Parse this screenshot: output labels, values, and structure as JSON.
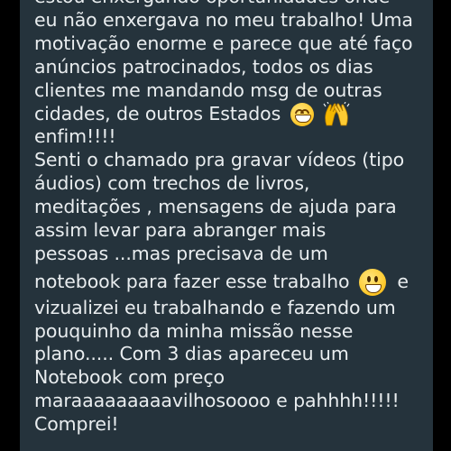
{
  "message": {
    "lines": [
      "estou enxergando oportunidades onde",
      "eu não enxergava no meu trabalho! Uma",
      "motivação enorme e parece que até faço",
      "anúncios patrocinados, todos os dias",
      "clientes me mandando msg de outras",
      "cidades, de outros Estados",
      "enfim!!!!",
      "Senti o chamado pra gravar vídeos (tipo",
      "áudios) com trechos de livros,",
      "meditações , mensagens de ajuda para",
      "assim levar para abranger mais",
      "pessoas ...mas precisava de um",
      "notebook para fazer esse trabalho",
      "vizualizei eu trabalhando e fazendo um",
      "pouquinho da minha missão nesse",
      "plano..... Com 3 dias apareceu um",
      "Notebook com preço",
      "maraaaaaaaaavilhosoooo e pahhhh!!!!!",
      "Comprei!"
    ],
    "line_13_suffix": "e",
    "emojis": {
      "line_6": [
        "grinning-face-with-smiling-eyes-emoji",
        "raising-hands-emoji"
      ],
      "line_13": [
        "grinning-face-emoji"
      ]
    }
  },
  "colors": {
    "background": "#000000",
    "bubble": "#25333c",
    "text": "#e9edef"
  }
}
